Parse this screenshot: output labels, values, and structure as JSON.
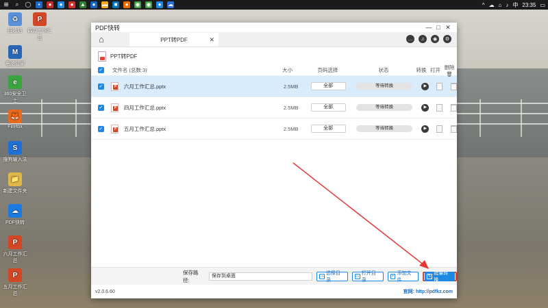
{
  "taskbar": {
    "time": "23:35"
  },
  "desktop_icons": [
    {
      "label": "回收站",
      "color": "#5b8fd6",
      "glyph": "♻"
    },
    {
      "label": "电脑管家",
      "color": "#2a66b8",
      "glyph": "M"
    },
    {
      "label": "360安全卫士",
      "color": "#3aa441",
      "glyph": "e"
    },
    {
      "label": "Firefox",
      "color": "#e66a1f",
      "glyph": "🦊"
    },
    {
      "label": "搜狗输入法",
      "color": "#1f6fd6",
      "glyph": "S"
    },
    {
      "label": "新建文件夹",
      "color": "#e0b84a",
      "glyph": "📁"
    },
    {
      "label": "PDF快转",
      "color": "#1c7be0",
      "glyph": "☁"
    },
    {
      "label": "六月工作汇总",
      "color": "#d24726",
      "glyph": "P"
    },
    {
      "label": "五月工作汇总",
      "color": "#d24726",
      "glyph": "P"
    }
  ],
  "desktop_icon_top": {
    "label": "四月工作汇总",
    "color": "#d24726",
    "glyph": "P"
  },
  "window": {
    "title": "PDF快转",
    "tab_label": "PPT转PDF",
    "section_title": "PPT转PDF",
    "version": "v2.0.6.60",
    "website": "官网: http://pdfkz.com"
  },
  "table": {
    "headers": {
      "name": "文件名 (总数:3)",
      "size": "大小",
      "page": "页码选择",
      "status": "状态",
      "convert": "转换",
      "open": "打开",
      "delete": "删除"
    },
    "rows": [
      {
        "name": "六月工作汇总.pptx",
        "size": "2.5MB",
        "page": "全部",
        "status": "等待转换"
      },
      {
        "name": "四月工作汇总.pptx",
        "size": "2.5MB",
        "page": "全部",
        "status": "等待转换"
      },
      {
        "name": "五月工作汇总.pptx",
        "size": "2.5MB",
        "page": "全部",
        "status": "等待转换"
      }
    ]
  },
  "bottom": {
    "save_label": "保存路径:",
    "save_value": "保存到桌面",
    "choose_dir": "选择目录",
    "open_dir": "打开目录",
    "add_file": "添加文件",
    "batch_convert": "批量转换"
  },
  "colors": {
    "accent": "#1e88e5",
    "highlight": "#e53935"
  }
}
